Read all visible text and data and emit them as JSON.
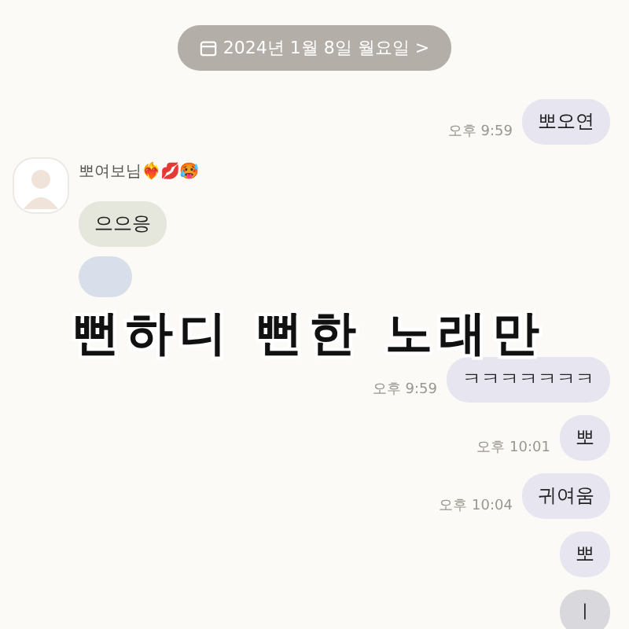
{
  "date_chip": {
    "label": "2024년 1월 8일 월요일 >"
  },
  "messages": [
    {
      "kind": "mine",
      "text": "뽀오연",
      "time": "오후 9:59"
    },
    {
      "kind": "sender",
      "name": "뽀여보님❤️‍🔥💋🥵"
    },
    {
      "kind": "theirs",
      "text": "으으응"
    },
    {
      "kind": "theirs_hidden"
    },
    {
      "kind": "mine",
      "text": "ㅋㅋㅋㅋㅋㅋㅋ",
      "time": "오후 9:59"
    },
    {
      "kind": "mine",
      "text": "뽀",
      "time": "오후 10:01"
    },
    {
      "kind": "mine",
      "text": "귀여움",
      "time": "오후 10:04"
    },
    {
      "kind": "mine",
      "text": "뽀"
    },
    {
      "kind": "mine_cut",
      "text": "ㅣ"
    }
  ],
  "caption": "뻔하디 뻔한 노래만"
}
